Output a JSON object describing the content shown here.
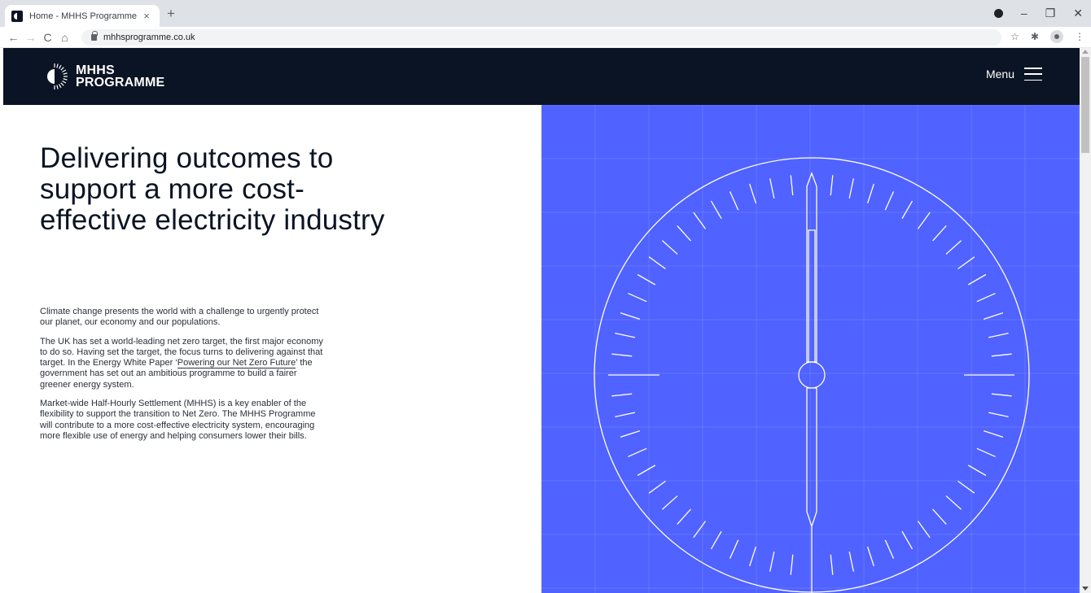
{
  "browser": {
    "tab_title": "Home - MHHS Programme",
    "tab_close": "×",
    "new_tab": "+",
    "url": "mhhsprogramme.co.uk",
    "window_minimize": "–",
    "window_restore": "❐",
    "window_close": "✕"
  },
  "header": {
    "logo_line1": "MHHS",
    "logo_line2": "PROGRAMME",
    "menu_label": "Menu"
  },
  "hero": {
    "title": "Delivering outcomes to support a more cost-effective electricity industry",
    "para1": "Climate change presents the world with a challenge to urgently protect our planet, our economy and our populations.",
    "para2_before": "The UK has set a world-leading net zero target, the first major economy to do so. Having set the target, the focus turns to delivering against that target. In the Energy White Paper ‘",
    "para2_link": "Powering our Net Zero Future",
    "para2_after": "’ the government has set out an ambitious programme to build a fairer greener energy system.",
    "para3": "Market-wide Half-Hourly Settlement (MHHS) is a key enabler of the flexibility to support the transition to Net Zero. The MHHS Programme will contribute to a more cost-effective electricity system, encouraging more flexible use of energy and helping consumers lower their bills."
  },
  "colors": {
    "header_bg": "#0b1424",
    "panel_bg": "#5062ff",
    "dial_stroke": "#ffffff"
  },
  "icons": {
    "logo": "half-sun-logo-icon",
    "menu": "hamburger-icon",
    "illustration": "dial-gauge-icon"
  }
}
